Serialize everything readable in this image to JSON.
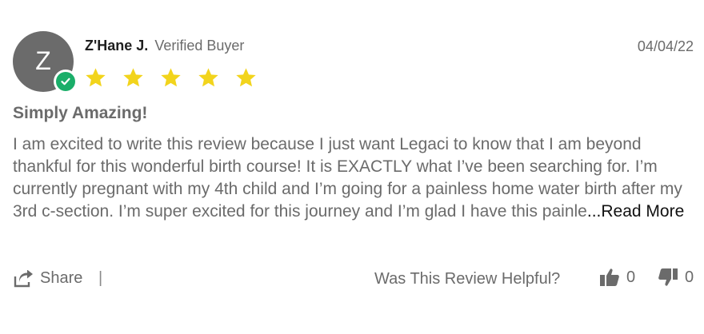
{
  "review": {
    "avatar_letter": "Z",
    "author": "Z'Hane J.",
    "buyer_label": "Verified Buyer",
    "date": "04/04/22",
    "rating": 5,
    "star_color": "#f2d41c",
    "title": "Simply Amazing!",
    "body": "I am excited to write this review because I just want Legaci to know that I am beyond thankful for this wonderful birth course! It is EXACTLY what I’ve been searching for. I’m currently pregnant with my 4th child and I’m going for a painless home water birth after my 3rd c-section. I’m super excited for this journey and I’m glad I have this painle",
    "read_more": "...Read More"
  },
  "footer": {
    "share_label": "Share",
    "divider": "|",
    "helpful_question": "Was This Review Helpful?",
    "thumbs_up_count": "0",
    "thumbs_down_count": "0"
  },
  "colors": {
    "text_gray": "#6b6b6b",
    "author_dark": "#1f1f1f",
    "verified_green": "#1aae69",
    "avatar_bg": "#6b6b6b"
  }
}
